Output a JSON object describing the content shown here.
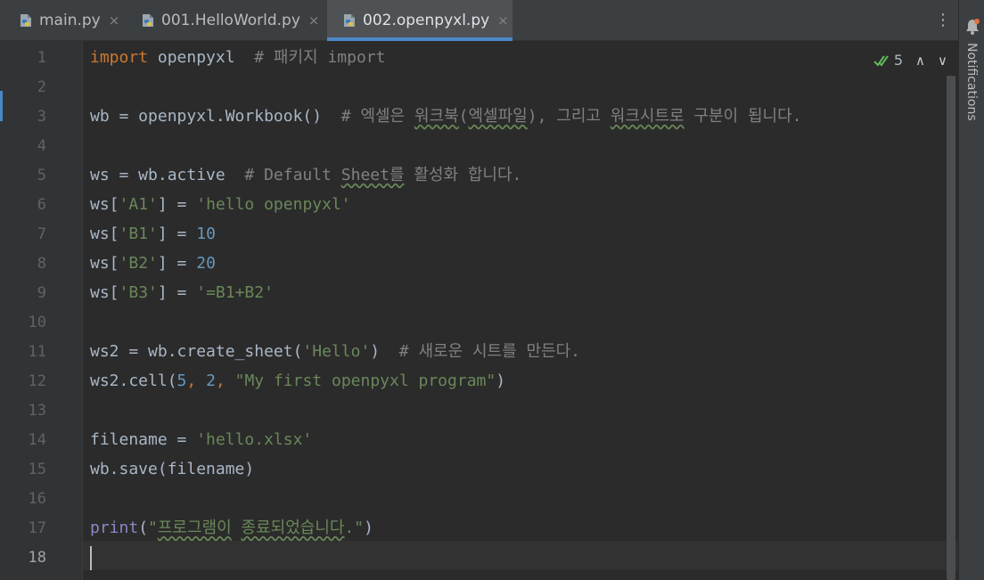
{
  "tabs": [
    {
      "label": "main.py",
      "close": "×"
    },
    {
      "label": "001.HelloWorld.py",
      "close": "×"
    },
    {
      "label": "002.openpyxl.py",
      "close": "×"
    }
  ],
  "tab_more": "⋮",
  "inspection": {
    "count": "5",
    "prev": "∧",
    "next": "∨"
  },
  "line_numbers": [
    "1",
    "2",
    "3",
    "4",
    "5",
    "6",
    "7",
    "8",
    "9",
    "10",
    "11",
    "12",
    "13",
    "14",
    "15",
    "16",
    "17",
    "18"
  ],
  "code": {
    "l1": {
      "kw": "import",
      "mod": " openpyxl  ",
      "com": "# 패키지 import"
    },
    "l3": {
      "a": "wb = openpyxl.Workbook()  ",
      "c1": "# 엑셀은 ",
      "c2": "워크북",
      "c3": "(",
      "c4": "엑셀파일",
      "c5": "), 그리고 ",
      "c6": "워크시트로",
      "c7": " 구분이 됩니다."
    },
    "l5": {
      "a": "ws = wb.active  ",
      "c1": "# Default ",
      "c2": "Sheet를",
      "c3": " 활성화 합니다."
    },
    "l6": {
      "a": "ws[",
      "s": "'A1'",
      "b": "] = ",
      "v": "'hello openpyxl'"
    },
    "l7": {
      "a": "ws[",
      "s": "'B1'",
      "b": "] = ",
      "v": "10"
    },
    "l8": {
      "a": "ws[",
      "s": "'B2'",
      "b": "] = ",
      "v": "20"
    },
    "l9": {
      "a": "ws[",
      "s": "'B3'",
      "b": "] = ",
      "v": "'=B1+B2'"
    },
    "l11": {
      "a": "ws2 = wb.create_sheet(",
      "s": "'Hello'",
      "b": ")  ",
      "c": "# 새로운 시트를 만든다."
    },
    "l12": {
      "a": "ws2.cell(",
      "n1": "5",
      "k1": ", ",
      "n2": "2",
      "k2": ", ",
      "s": "\"My first openpyxl program\"",
      "b": ")"
    },
    "l14": {
      "a": "filename = ",
      "s": "'hello.xlsx'"
    },
    "l15": {
      "a": "wb.save(filename)"
    },
    "l17": {
      "fn": "print",
      "a": "(",
      "s1": "\"",
      "s2": "프로그램이",
      "s3": " ",
      "s4": "종료되었습니다",
      "s5": ".\"",
      "b": ")"
    }
  },
  "notifications_label": "Notifications",
  "colors": {
    "accent": "#4a88c7",
    "keyword": "#cc7832",
    "string": "#6a8759",
    "number": "#6897bb",
    "comment": "#808080",
    "builtin": "#8888c6"
  }
}
